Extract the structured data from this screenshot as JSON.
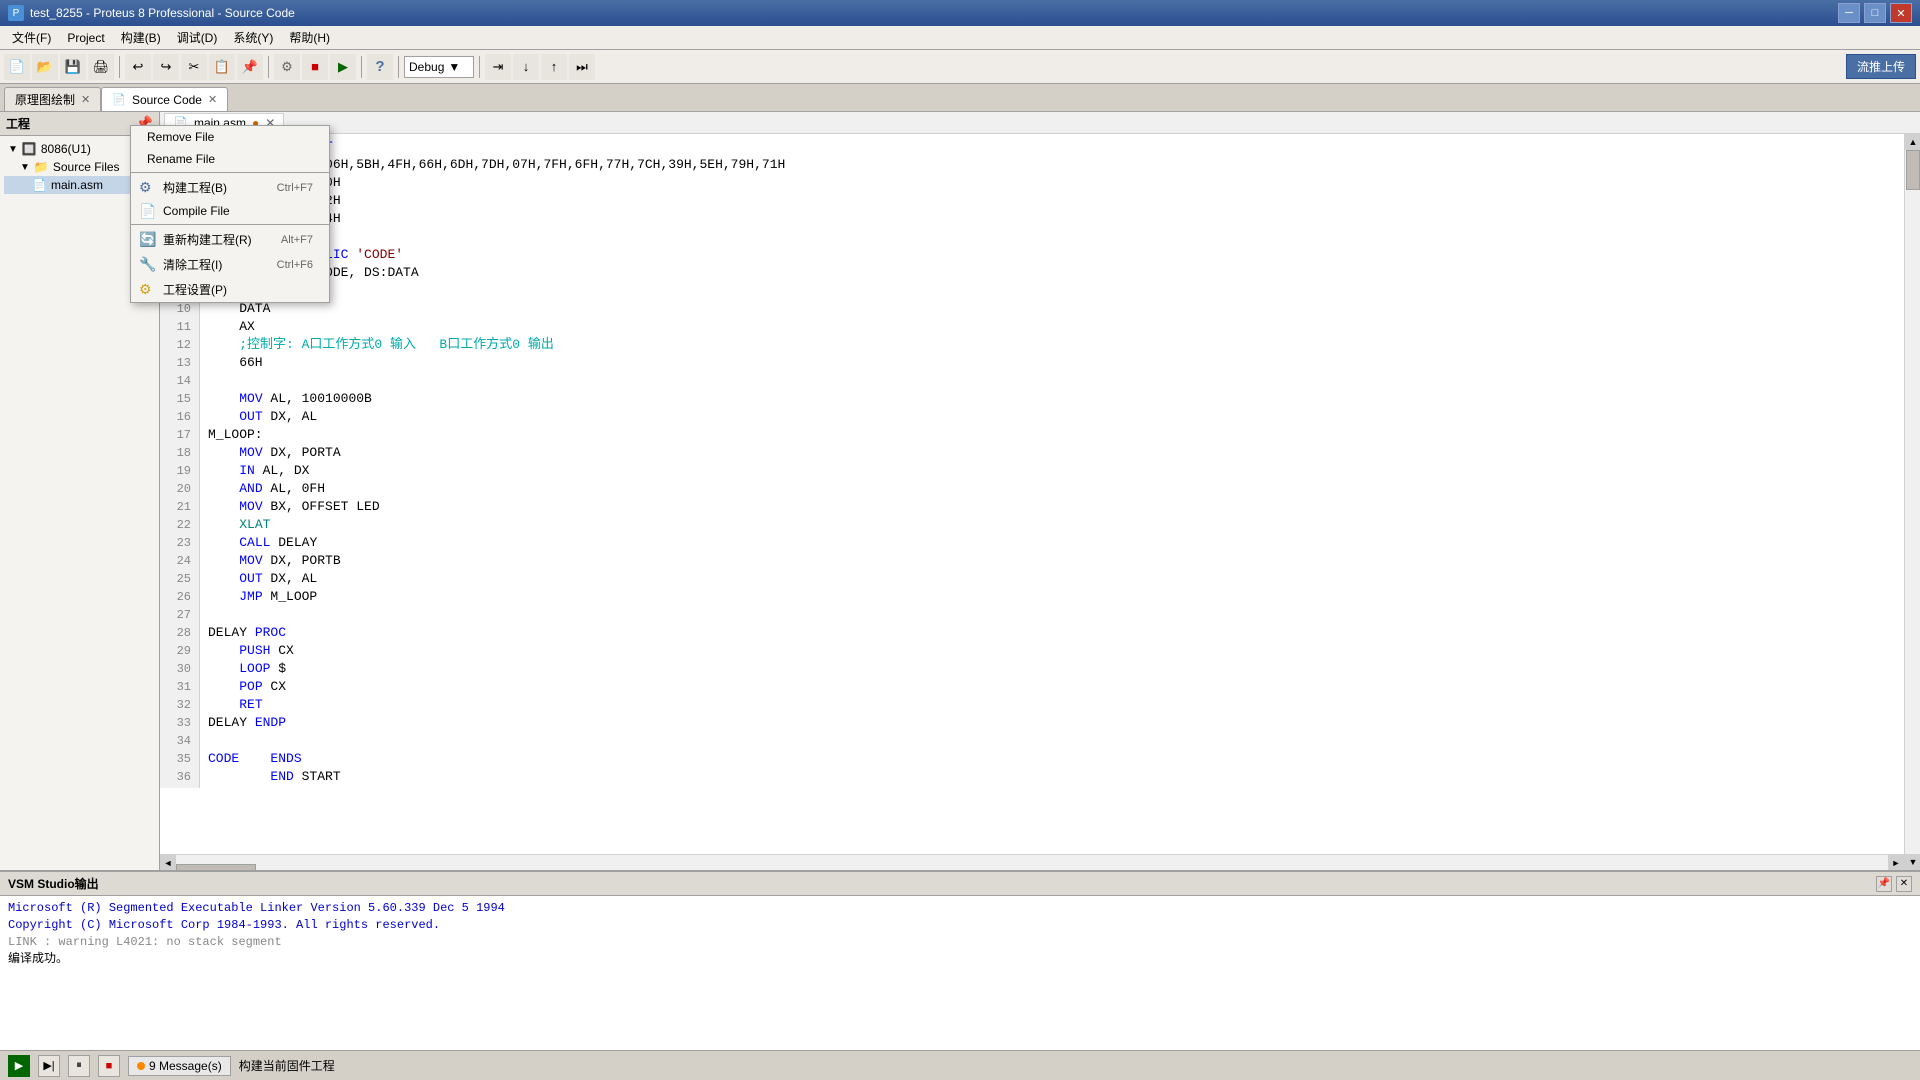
{
  "window": {
    "title": "test_8255 - Proteus 8 Professional - Source Code",
    "controls": {
      "min": "─",
      "max": "□",
      "close": "✕"
    }
  },
  "menubar": {
    "items": [
      "文件(F)",
      "Project",
      "构建(B)",
      "调试(D)",
      "系统(Y)",
      "帮助(H)"
    ]
  },
  "toolbar": {
    "debug_label": "Debug",
    "upload_btn": "流推上传"
  },
  "tabs": [
    {
      "label": "原理图绘制",
      "active": false,
      "closeable": true
    },
    {
      "label": "Source Code",
      "active": true,
      "closeable": true
    }
  ],
  "sidebar": {
    "header": "工程",
    "tree": [
      {
        "level": 0,
        "label": "8086(U1)",
        "type": "component",
        "expanded": true
      },
      {
        "level": 1,
        "label": "Source Files",
        "type": "folder",
        "expanded": true
      },
      {
        "level": 2,
        "label": "main.asm",
        "type": "file",
        "selected": true
      }
    ]
  },
  "editor": {
    "filename": "main.asm",
    "lines": [
      {
        "num": 1,
        "text": "    DATA SEGMENT",
        "parts": [
          {
            "t": "    DATA SEGMENT",
            "c": "blue"
          }
        ]
      },
      {
        "num": 2,
        "text": "    LED DB 3FH,06H,5BH,4FH,66H,6DH,7DH,07H,7FH,6FH,77H,7CH,39H,5EH,79H,71H",
        "parts": []
      },
      {
        "num": 3,
        "text": "    PORTA EQU 60H",
        "parts": []
      },
      {
        "num": 4,
        "text": "    PORTB EQU 62H",
        "parts": []
      },
      {
        "num": 5,
        "text": "    PORTC EQU 64H",
        "parts": []
      },
      {
        "num": 6,
        "text": "",
        "parts": []
      },
      {
        "num": 7,
        "text": "    SEGMENT PUBLIC 'CODE'",
        "parts": [
          {
            "t": "    SEGMENT PUBLIC 'CODE'",
            "c": "blue"
          }
        ]
      },
      {
        "num": 8,
        "text": "    ASSUME CS:CODE, DS:DATA",
        "parts": []
      },
      {
        "num": 9,
        "text": "",
        "parts": []
      },
      {
        "num": 10,
        "text": "    DATA",
        "parts": []
      },
      {
        "num": 11,
        "text": "    AX",
        "parts": []
      },
      {
        "num": 12,
        "text": "    ;控制字: A口工作方式0 输入   B口工作方式0 输出",
        "parts": [
          {
            "t": "    ;控制字: A口工作方式0 输入   B口工作方式0 输出",
            "c": "comment"
          }
        ]
      },
      {
        "num": 13,
        "text": "    66H",
        "parts": []
      },
      {
        "num": 14,
        "text": "",
        "parts": []
      },
      {
        "num": 15,
        "text": "    MOV AL, 10010000B",
        "parts": [
          {
            "t": "    MOV ",
            "c": "blue"
          },
          {
            "t": "AL, 10010000B",
            "c": ""
          }
        ]
      },
      {
        "num": 16,
        "text": "    OUT DX, AL",
        "parts": [
          {
            "t": "    OUT ",
            "c": "blue"
          },
          {
            "t": "DX, AL",
            "c": ""
          }
        ]
      },
      {
        "num": 17,
        "text": "M_LOOP:",
        "parts": [
          {
            "t": "M_LOOP:",
            "c": ""
          }
        ]
      },
      {
        "num": 18,
        "text": "    MOV DX, PORTA",
        "parts": [
          {
            "t": "    MOV ",
            "c": "blue"
          },
          {
            "t": "DX, PORTA",
            "c": ""
          }
        ]
      },
      {
        "num": 19,
        "text": "    IN AL, DX",
        "parts": [
          {
            "t": "    IN ",
            "c": "blue"
          },
          {
            "t": "AL, DX",
            "c": ""
          }
        ]
      },
      {
        "num": 20,
        "text": "    AND AL, 0FH",
        "parts": [
          {
            "t": "    AND ",
            "c": "blue"
          },
          {
            "t": "AL, 0FH",
            "c": ""
          }
        ]
      },
      {
        "num": 21,
        "text": "    MOV BX, OFFSET LED",
        "parts": [
          {
            "t": "    MOV ",
            "c": "blue"
          },
          {
            "t": "BX, OFFSET LED",
            "c": ""
          }
        ]
      },
      {
        "num": 22,
        "text": "    XLAT",
        "parts": [
          {
            "t": "    XLAT",
            "c": "cyan"
          }
        ]
      },
      {
        "num": 23,
        "text": "    CALL DELAY",
        "parts": [
          {
            "t": "    CALL ",
            "c": "blue"
          },
          {
            "t": "DELAY",
            "c": ""
          }
        ]
      },
      {
        "num": 24,
        "text": "    MOV DX, PORTB",
        "parts": [
          {
            "t": "    MOV ",
            "c": "blue"
          },
          {
            "t": "DX, PORTB",
            "c": ""
          }
        ]
      },
      {
        "num": 25,
        "text": "    OUT DX, AL",
        "parts": [
          {
            "t": "    OUT ",
            "c": "blue"
          },
          {
            "t": "DX, AL",
            "c": ""
          }
        ]
      },
      {
        "num": 26,
        "text": "    JMP M_LOOP",
        "parts": [
          {
            "t": "    JMP ",
            "c": "blue"
          },
          {
            "t": "M_LOOP",
            "c": ""
          }
        ]
      },
      {
        "num": 27,
        "text": "",
        "parts": []
      },
      {
        "num": 28,
        "text": "DELAY PROC",
        "parts": [
          {
            "t": "DELAY PROC",
            "c": ""
          }
        ]
      },
      {
        "num": 29,
        "text": "    PUSH CX",
        "parts": [
          {
            "t": "    PUSH ",
            "c": "blue"
          },
          {
            "t": "CX",
            "c": ""
          }
        ]
      },
      {
        "num": 30,
        "text": "    LOOP $",
        "parts": [
          {
            "t": "    LOOP ",
            "c": "blue"
          },
          {
            "t": "$",
            "c": ""
          }
        ]
      },
      {
        "num": 31,
        "text": "    POP CX",
        "parts": [
          {
            "t": "    POP ",
            "c": "blue"
          },
          {
            "t": "CX",
            "c": ""
          }
        ]
      },
      {
        "num": 32,
        "text": "    RET",
        "parts": [
          {
            "t": "    RET",
            "c": "blue"
          }
        ]
      },
      {
        "num": 33,
        "text": "DELAY ENDP",
        "parts": [
          {
            "t": "DELAY ENDP",
            "c": ""
          }
        ]
      },
      {
        "num": 34,
        "text": "",
        "parts": []
      },
      {
        "num": 35,
        "text": "CODE    ENDS",
        "parts": [
          {
            "t": "CODE    ENDS",
            "c": "blue"
          }
        ]
      },
      {
        "num": 36,
        "text": "        END START",
        "parts": [
          {
            "t": "        END ",
            "c": "blue"
          },
          {
            "t": "START",
            "c": ""
          }
        ]
      }
    ]
  },
  "context_menu": {
    "items": [
      {
        "label": "Remove File",
        "shortcut": "",
        "type": "item"
      },
      {
        "label": "Rename File",
        "shortcut": "",
        "type": "item"
      },
      {
        "type": "sep"
      },
      {
        "label": "构建工程(B)",
        "shortcut": "Ctrl+F7",
        "type": "item",
        "hasIcon": true
      },
      {
        "label": "Compile File",
        "shortcut": "",
        "type": "item",
        "hasIcon": true
      },
      {
        "type": "sep"
      },
      {
        "label": "重新构建工程(R)",
        "shortcut": "Alt+F7",
        "type": "item",
        "hasIcon": true
      },
      {
        "label": "清除工程(I)",
        "shortcut": "Ctrl+F6",
        "type": "item",
        "hasIcon": true
      },
      {
        "label": "工程设置(P)",
        "shortcut": "",
        "type": "item",
        "hasIcon": true
      }
    ]
  },
  "output": {
    "header": "VSM Studio输出",
    "lines": [
      "",
      "Microsoft (R) Segmented Executable Linker  Version 5.60.339 Dec  5 1994",
      "Copyright (C) Microsoft Corp 1984-1993.  All rights reserved.",
      "",
      "LINK : warning L4021: no stack segment",
      "编译成功。"
    ]
  },
  "statusbar": {
    "messages_count": "9 Message(s)",
    "project_label": "构建当前固件工程"
  }
}
